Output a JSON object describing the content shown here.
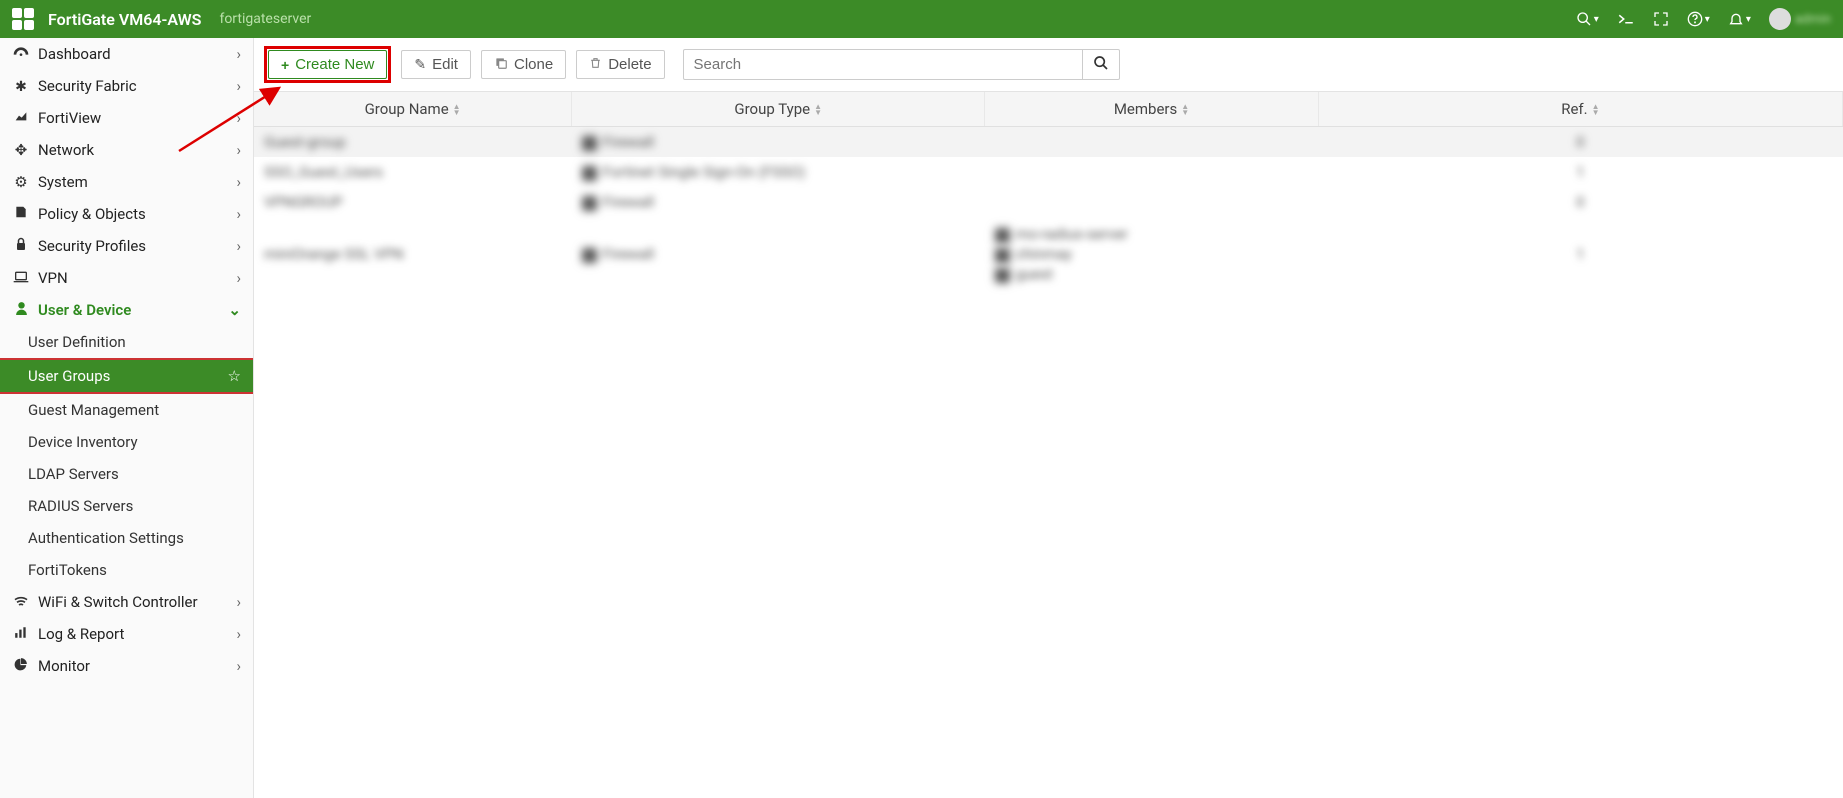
{
  "header": {
    "product": "FortiGate VM64-AWS",
    "hostname": "fortigateserver",
    "user_label": "admin"
  },
  "sidebar": {
    "items": [
      {
        "icon": "tachometer",
        "label": "Dashboard",
        "expand": true
      },
      {
        "icon": "fabric",
        "label": "Security Fabric",
        "expand": true
      },
      {
        "icon": "chart",
        "label": "FortiView",
        "expand": true
      },
      {
        "icon": "arrows",
        "label": "Network",
        "expand": true
      },
      {
        "icon": "gear",
        "label": "System",
        "expand": true
      },
      {
        "icon": "policy",
        "label": "Policy & Objects",
        "expand": true
      },
      {
        "icon": "lock",
        "label": "Security Profiles",
        "expand": true
      },
      {
        "icon": "laptop",
        "label": "VPN",
        "expand": true
      },
      {
        "icon": "user",
        "label": "User & Device",
        "expand": true,
        "active": true,
        "children": [
          {
            "label": "User Definition"
          },
          {
            "label": "User Groups",
            "selected": true
          },
          {
            "label": "Guest Management"
          },
          {
            "label": "Device Inventory"
          },
          {
            "label": "LDAP Servers"
          },
          {
            "label": "RADIUS Servers"
          },
          {
            "label": "Authentication Settings"
          },
          {
            "label": "FortiTokens"
          }
        ]
      },
      {
        "icon": "wifi",
        "label": "WiFi & Switch Controller",
        "expand": true
      },
      {
        "icon": "barchart",
        "label": "Log & Report",
        "expand": true
      },
      {
        "icon": "pie",
        "label": "Monitor",
        "expand": true
      }
    ]
  },
  "toolbar": {
    "create": "Create New",
    "edit": "Edit",
    "clone": "Clone",
    "delete": "Delete",
    "search_placeholder": "Search"
  },
  "table": {
    "columns": [
      "Group Name",
      "Group Type",
      "Members",
      "Ref."
    ],
    "rows": [
      {
        "name": "Guest-group",
        "type": "Firewall",
        "members": [],
        "ref": "0",
        "hl": true
      },
      {
        "name": "SSO_Guest_Users",
        "type": "Fortinet Single Sign-On (FSSO)",
        "members": [],
        "ref": "1"
      },
      {
        "name": "VPNGROUP",
        "type": "Firewall",
        "members": [],
        "ref": "0"
      },
      {
        "name": "miniOrange SSL VPN",
        "type": "Firewall",
        "members": [
          "mo-radius-server",
          "chinmay",
          "guest"
        ],
        "ref": "1"
      }
    ]
  }
}
